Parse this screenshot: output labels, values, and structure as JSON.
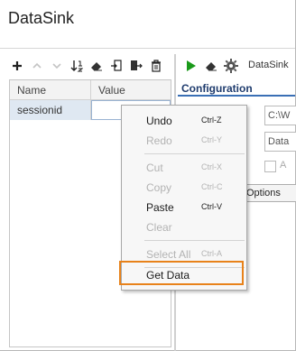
{
  "window": {
    "title": "DataSink"
  },
  "grid": {
    "columns": [
      "Name",
      "Value"
    ],
    "rows": [
      {
        "name": "sessionid",
        "value": ""
      }
    ]
  },
  "right_toolbar": {
    "label": "DataSink"
  },
  "config": {
    "title": "Configuration",
    "field1": "C:\\W",
    "field2": "Data",
    "check_label": "A",
    "options_label": "Options"
  },
  "context_menu": {
    "items": [
      {
        "label": "Undo",
        "shortcut": "Ctrl-Z",
        "enabled": true
      },
      {
        "label": "Redo",
        "shortcut": "Ctrl-Y",
        "enabled": false
      },
      {
        "label": "Cut",
        "shortcut": "Ctrl-X",
        "enabled": false
      },
      {
        "label": "Copy",
        "shortcut": "Ctrl-C",
        "enabled": false
      },
      {
        "label": "Paste",
        "shortcut": "Ctrl-V",
        "enabled": true
      },
      {
        "label": "Clear",
        "shortcut": "",
        "enabled": false
      },
      {
        "label": "Select All",
        "shortcut": "Ctrl-A",
        "enabled": false
      },
      {
        "label": "Get Data",
        "shortcut": "",
        "enabled": true
      }
    ]
  },
  "colors": {
    "highlight_border": "#e8821a",
    "run_green": "#1a9a1a",
    "accent_blue": "#3a6fb5"
  }
}
